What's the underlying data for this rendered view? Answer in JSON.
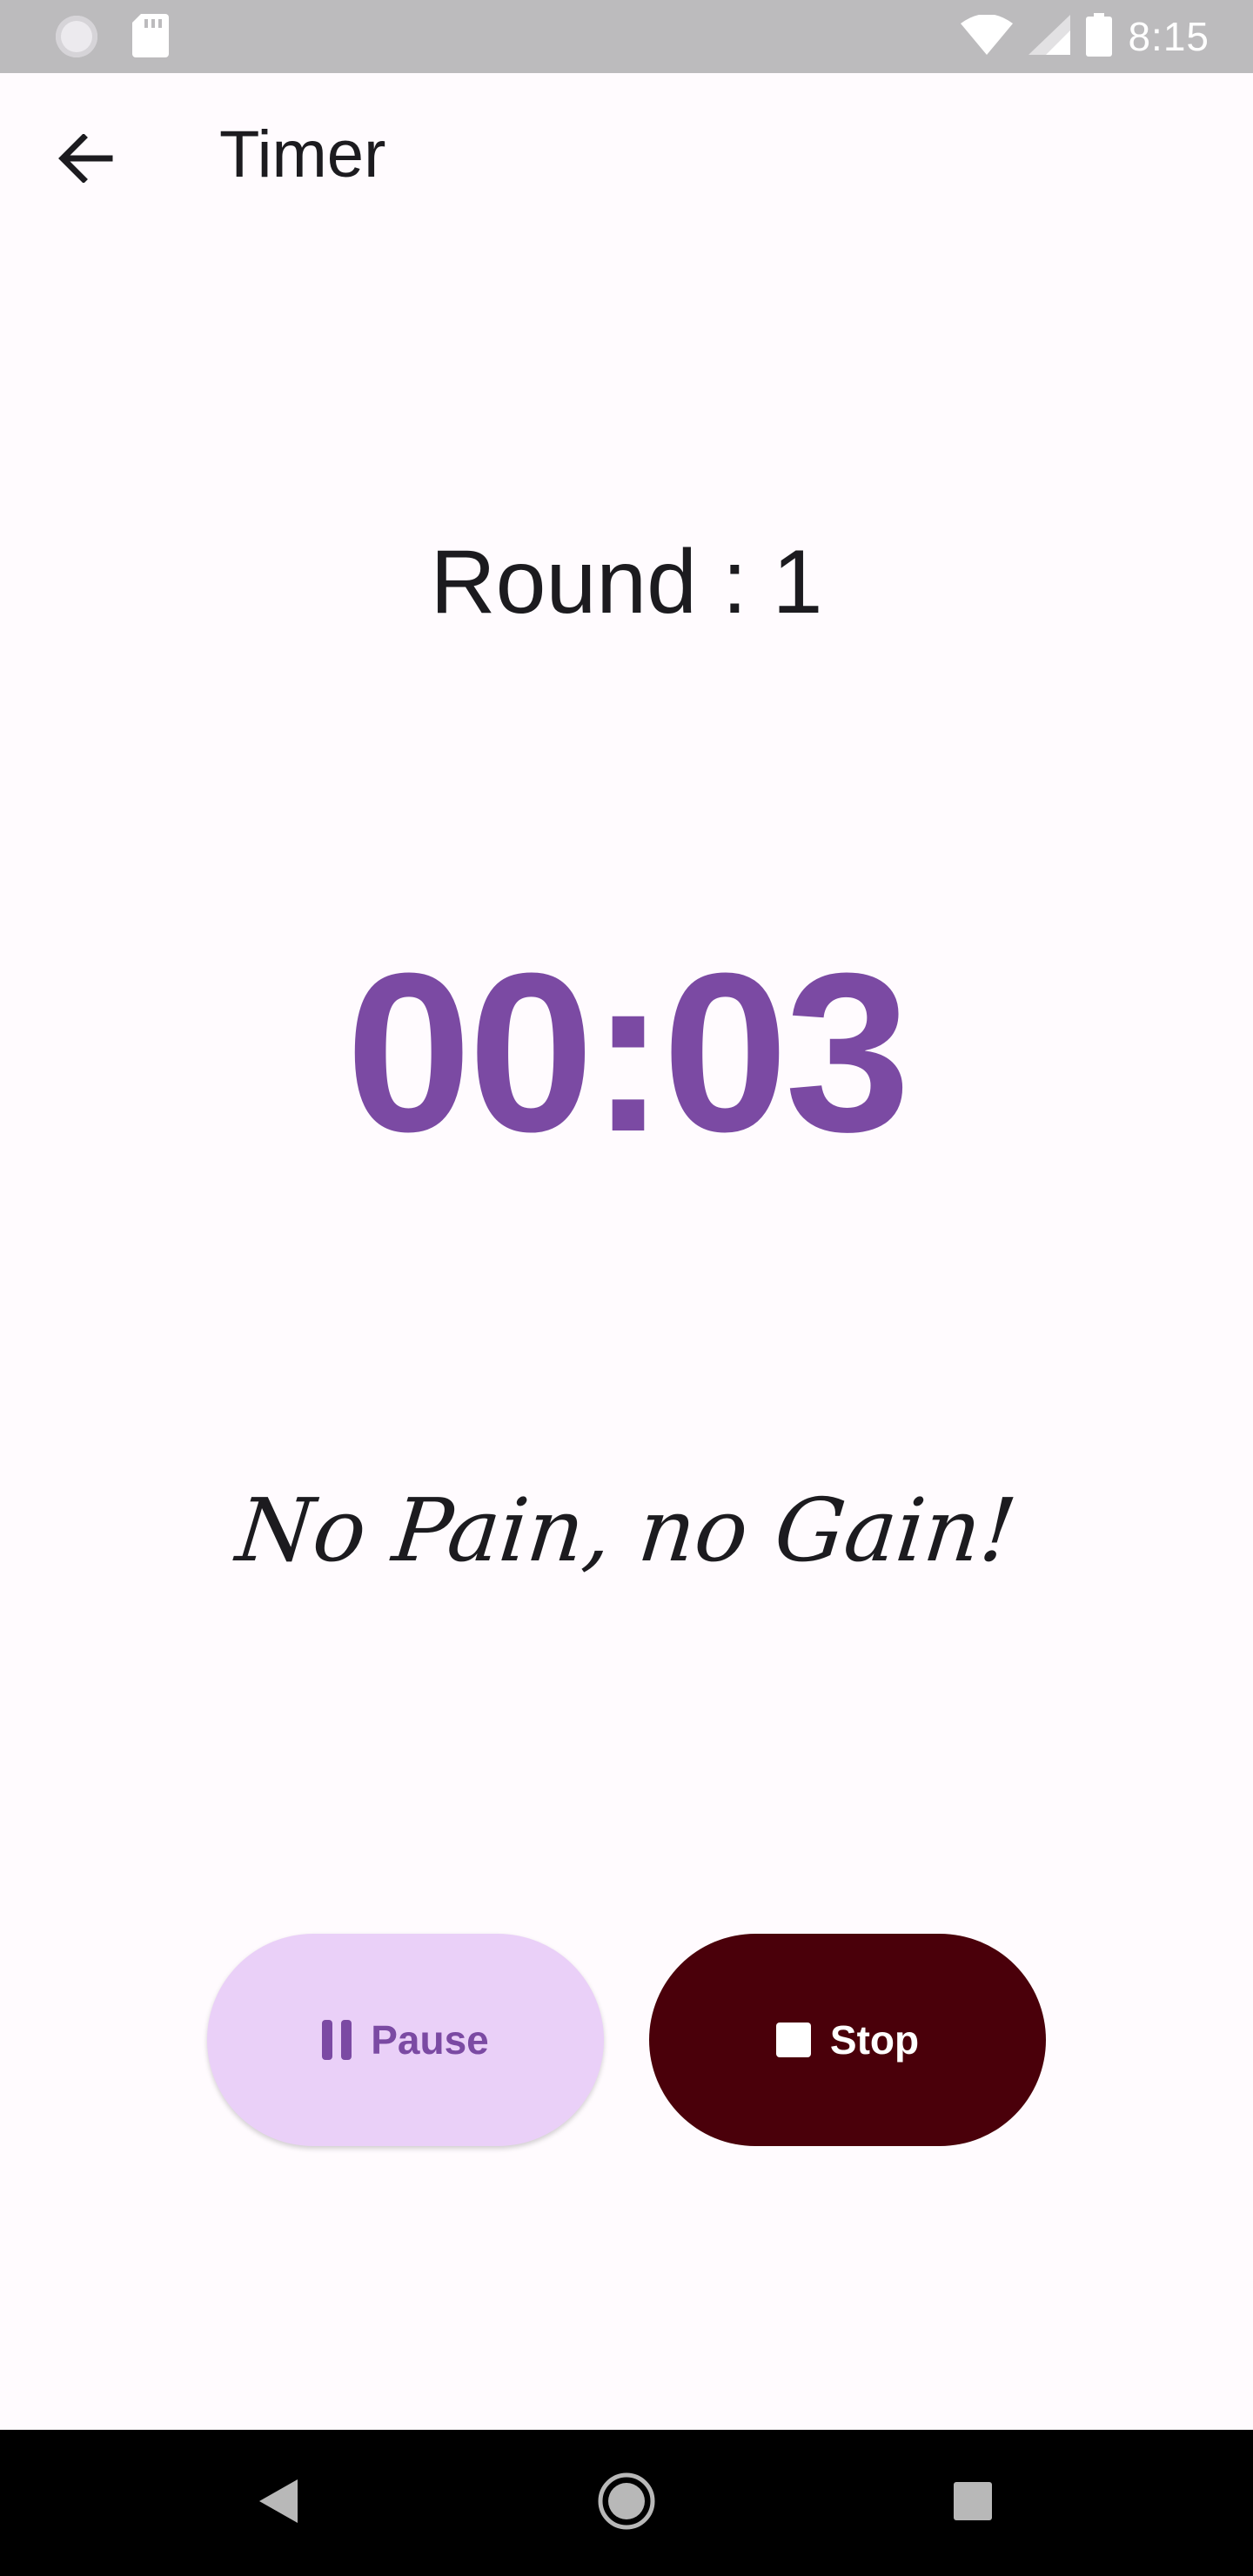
{
  "status_bar": {
    "time": "8:15",
    "left_icons": [
      "sync-icon",
      "sd-card-icon"
    ],
    "right_icons": [
      "wifi-icon",
      "cell-signal-icon",
      "battery-icon"
    ]
  },
  "app_bar": {
    "title": "Timer",
    "back_icon": "arrow-left-icon"
  },
  "round": {
    "label": "Round : 1"
  },
  "timer": {
    "value": "00:03"
  },
  "quote": {
    "text": "No Pain, no Gain!"
  },
  "actions": {
    "pause_label": "Pause",
    "stop_label": "Stop"
  },
  "nav_bar": {
    "icons": [
      "back-triangle-icon",
      "home-circle-icon",
      "recents-square-icon"
    ]
  },
  "colors": {
    "background": "#fffbfe",
    "accent": "#7b4aa3",
    "pause_button_bg": "#ead0f8",
    "stop_button_bg": "#4a000a"
  }
}
